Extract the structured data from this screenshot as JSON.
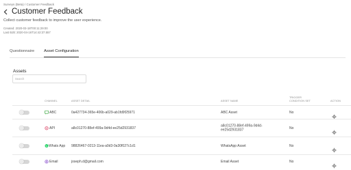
{
  "breadcrumb": "Surveys (Beta) / Customer Feedback",
  "title": "Customer Feedback",
  "description": "Collect customer feedback to improve the user experience.",
  "created": "Created: 2020-03-18T00:11:29:00",
  "last_edit": "Last Edit: 2020-04-16T14:42:37.557",
  "tabs": [
    {
      "label": "Questionnaire"
    },
    {
      "label": "Asset Configuration"
    }
  ],
  "assets": {
    "label": "Assets",
    "search_placeholder": "Search"
  },
  "table": {
    "headers": {
      "channel": "Channel",
      "asset_detail": "Asset Detail",
      "asset_name": "Asset Name",
      "trigger": "Trigger Condition Set",
      "action": "Action"
    },
    "rows": [
      {
        "channel": "ABC",
        "icon": "abc-channel-icon",
        "icon_color": "#4caf50",
        "detail": "0a427734-365e-406b-a029-ab1fd9f25971",
        "name": "ABC Asset",
        "trigger": "No"
      },
      {
        "channel": "API",
        "icon": "api-channel-icon",
        "icon_color": "#e05c7a",
        "detail": "a8c01270-88ef-499a-9d4d-ee25d2931837",
        "name": "a8c01270-88ef-499a-9d4d-ee25d2931837",
        "trigger": "No"
      },
      {
        "channel": "Whats App",
        "icon": "whatsapp-icon",
        "icon_color": "#25d366",
        "detail": "98826467-0213-11ea-a0d3-0a30f027c1d1",
        "name": "WhatsApp Asset",
        "trigger": "No"
      },
      {
        "channel": "Email",
        "icon": "email-icon",
        "icon_color": "#9c6bd6",
        "detail": "joseph.d@gmail.com",
        "name": "Email Asset",
        "trigger": "No"
      }
    ]
  }
}
